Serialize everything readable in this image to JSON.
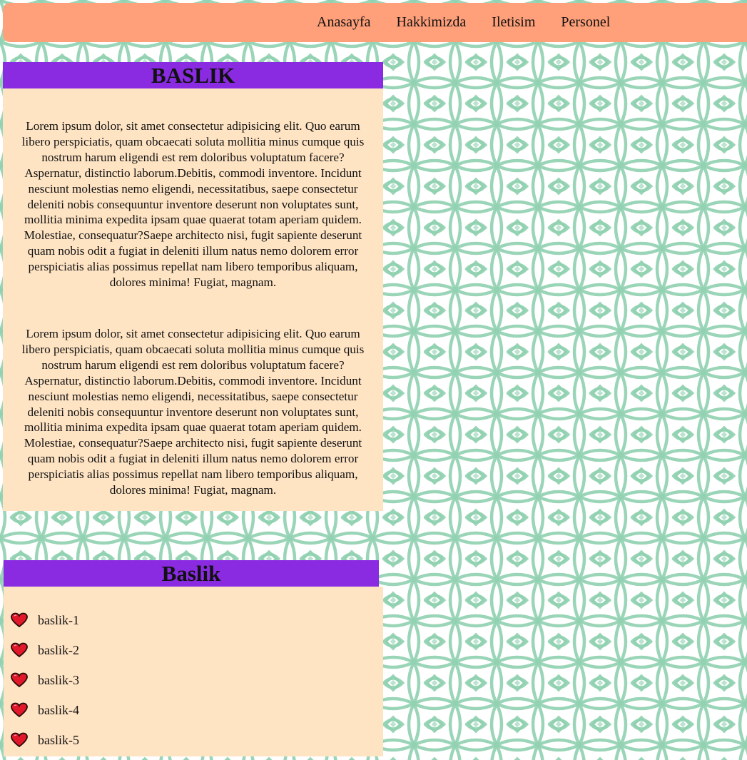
{
  "colors": {
    "topbar": "#ffa07a",
    "heading_bar": "#8a2be2",
    "card": "#ffe4c4",
    "pattern_stroke": "#8fd1b0",
    "heart_fill": "#e0182a",
    "heart_outline": "#2a0a0a"
  },
  "nav": {
    "items": [
      "Anasayfa",
      "Hakkimizda",
      "Iletisim",
      "Personel"
    ]
  },
  "main_section": {
    "title": "BASLIK",
    "paragraphs": [
      "Lorem ipsum dolor, sit amet consectetur adipisicing elit. Quo earum libero perspiciatis, quam obcaecati soluta mollitia minus cumque quis nostrum harum eligendi est rem doloribus voluptatum facere? Aspernatur, distinctio laborum.Debitis, commodi inventore. Incidunt nesciunt molestias nemo eligendi, necessitatibus, saepe consectetur deleniti nobis consequuntur inventore deserunt non voluptates sunt, mollitia minima expedita ipsam quae quaerat totam aperiam quidem. Molestiae, consequatur?Saepe architecto nisi, fugit sapiente deserunt quam nobis odit a fugiat in deleniti illum natus nemo dolorem error perspiciatis alias possimus repellat nam libero temporibus aliquam, dolores minima! Fugiat, magnam.",
      "Lorem ipsum dolor, sit amet consectetur adipisicing elit. Quo earum libero perspiciatis, quam obcaecati soluta mollitia minus cumque quis nostrum harum eligendi est rem doloribus voluptatum facere? Aspernatur, distinctio laborum.Debitis, commodi inventore. Incidunt nesciunt molestias nemo eligendi, necessitatibus, saepe consectetur deleniti nobis consequuntur inventore deserunt non voluptates sunt, mollitia minima expedita ipsam quae quaerat totam aperiam quidem. Molestiae, consequatur?Saepe architecto nisi, fugit sapiente deserunt quam nobis odit a fugiat in deleniti illum natus nemo dolorem error perspiciatis alias possimus repellat nam libero temporibus aliquam, dolores minima! Fugiat, magnam."
    ]
  },
  "list_section": {
    "title": "Baslik",
    "icon": "heart-icon",
    "items": [
      "baslik-1",
      "baslik-2",
      "baslik-3",
      "baslik-4",
      "baslik-5"
    ]
  }
}
